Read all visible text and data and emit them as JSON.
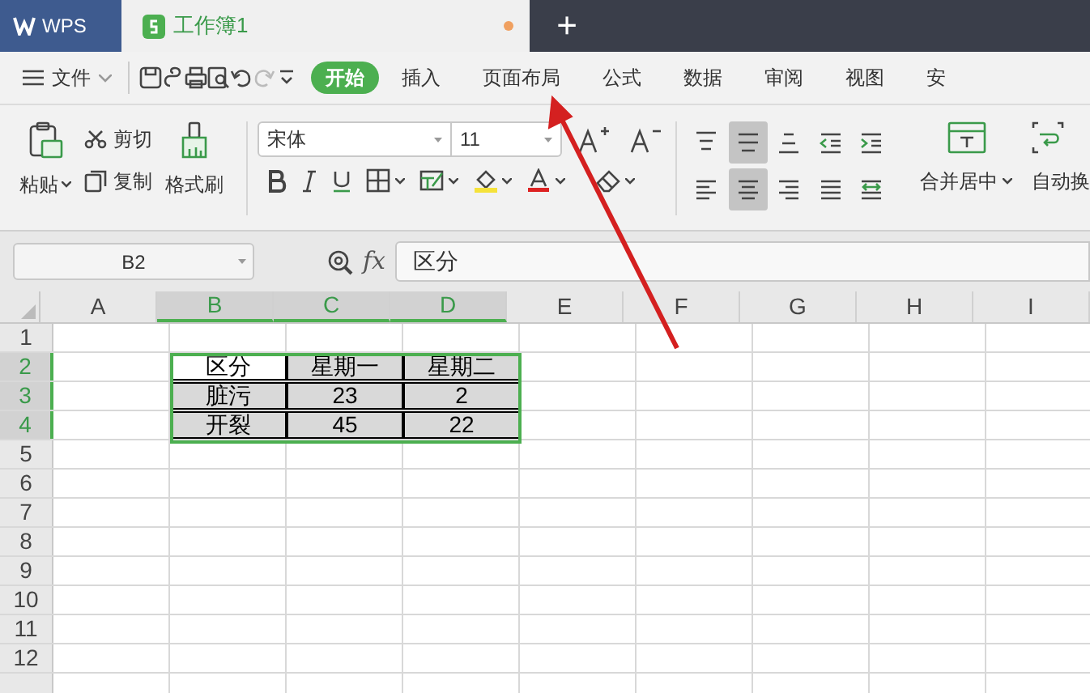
{
  "app_tab": {
    "label": "WPS"
  },
  "document_tab": {
    "label": "工作簿1",
    "unsaved": true
  },
  "new_tab": {
    "label": "+"
  },
  "menu": {
    "file": "文件",
    "tabs": [
      {
        "label": "开始",
        "selected": true
      },
      {
        "label": "插入",
        "selected": false
      },
      {
        "label": "页面布局",
        "selected": false
      },
      {
        "label": "公式",
        "selected": false
      },
      {
        "label": "数据",
        "selected": false
      },
      {
        "label": "审阅",
        "selected": false
      },
      {
        "label": "视图",
        "selected": false
      },
      {
        "label": "安",
        "selected": false
      }
    ]
  },
  "ribbon": {
    "paste": "粘贴",
    "cut": "剪切",
    "copy": "复制",
    "format_painter": "格式刷",
    "font_name": "宋体",
    "font_size": "11",
    "align_buttons": [
      {
        "kind": "top",
        "selected": false
      },
      {
        "kind": "middle",
        "selected": true
      },
      {
        "kind": "bottom",
        "selected": false
      },
      {
        "kind": "outdent",
        "selected": false
      },
      {
        "kind": "indent",
        "selected": false
      },
      {
        "kind": "left",
        "selected": false
      },
      {
        "kind": "center",
        "selected": true
      },
      {
        "kind": "right",
        "selected": false
      },
      {
        "kind": "justify",
        "selected": false
      },
      {
        "kind": "distribute",
        "selected": false
      }
    ],
    "merge": "合并居中",
    "wrap": "自动换"
  },
  "formula_bar": {
    "name_box": "B2",
    "fx": "fx",
    "formula": "区分"
  },
  "sheet": {
    "columns": [
      {
        "label": "A",
        "selected": false
      },
      {
        "label": "B",
        "selected": true
      },
      {
        "label": "C",
        "selected": true
      },
      {
        "label": "D",
        "selected": true
      },
      {
        "label": "E",
        "selected": false
      },
      {
        "label": "F",
        "selected": false
      },
      {
        "label": "G",
        "selected": false
      },
      {
        "label": "H",
        "selected": false
      },
      {
        "label": "I",
        "selected": false
      }
    ],
    "rows": [
      {
        "label": "1",
        "selected": false
      },
      {
        "label": "2",
        "selected": true,
        "cells": [
          {
            "text": "区分",
            "active": true
          },
          {
            "text": "星期一",
            "active": false
          },
          {
            "text": "星期二",
            "active": false
          }
        ]
      },
      {
        "label": "3",
        "selected": true,
        "cells": [
          {
            "text": "脏污",
            "active": false
          },
          {
            "text": "23",
            "active": false
          },
          {
            "text": "2",
            "active": false
          }
        ]
      },
      {
        "label": "4",
        "selected": true,
        "cells": [
          {
            "text": "开裂",
            "active": false
          },
          {
            "text": "45",
            "active": false
          },
          {
            "text": "22",
            "active": false
          }
        ]
      },
      {
        "label": "5",
        "selected": false
      },
      {
        "label": "6",
        "selected": false
      },
      {
        "label": "7",
        "selected": false
      },
      {
        "label": "8",
        "selected": false
      },
      {
        "label": "9",
        "selected": false
      },
      {
        "label": "10",
        "selected": false
      },
      {
        "label": "11",
        "selected": false
      },
      {
        "label": "12",
        "selected": false
      }
    ]
  }
}
